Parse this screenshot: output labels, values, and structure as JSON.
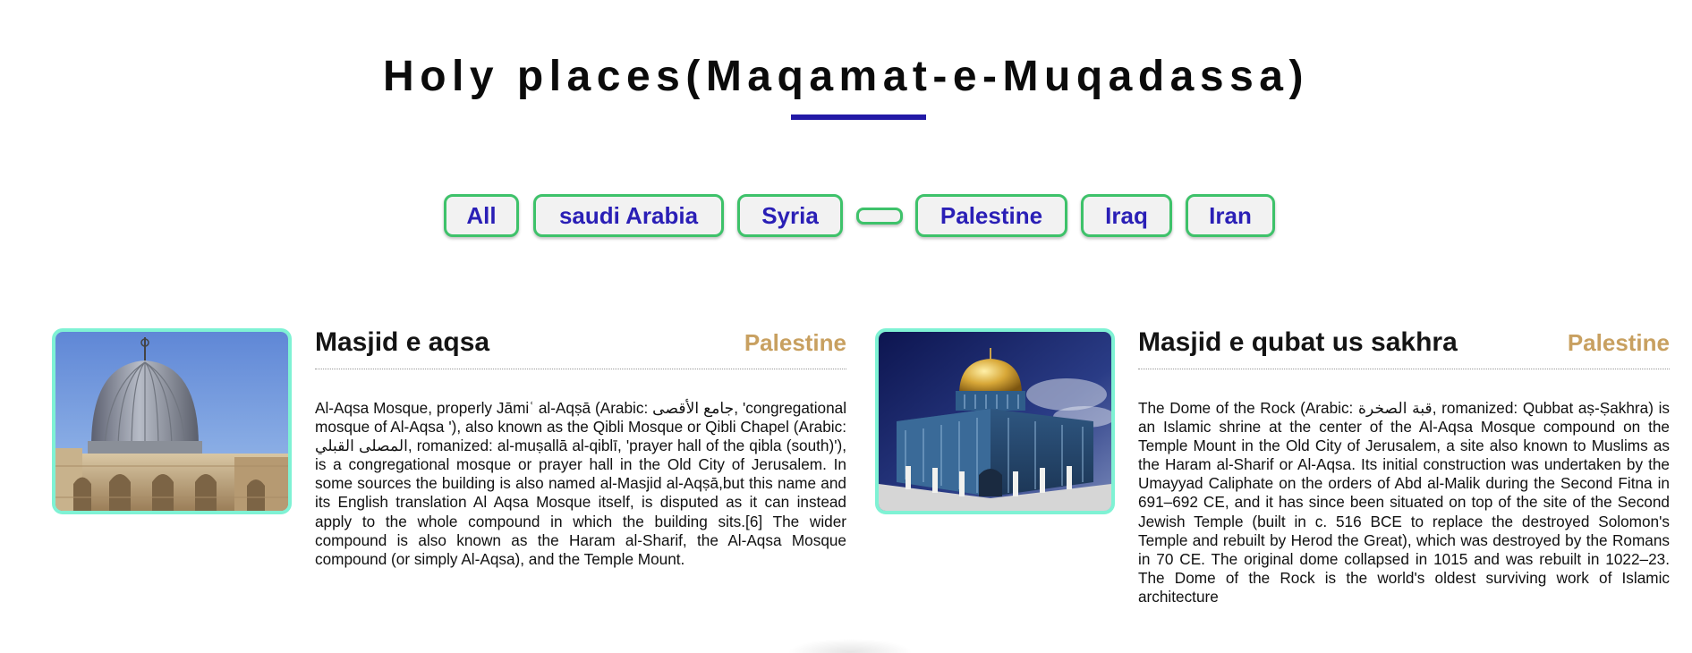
{
  "header": {
    "title": "Holy places(Maqamat-e-Muqadassa)",
    "accent_color": "#2219a6"
  },
  "filters": {
    "buttons": [
      {
        "label": "All"
      },
      {
        "label": "saudi Arabia"
      },
      {
        "label": "Syria"
      },
      {
        "label": ""
      },
      {
        "label": "Palestine"
      },
      {
        "label": "Iraq"
      },
      {
        "label": "Iran"
      }
    ],
    "border_color": "#3ec26a",
    "text_color": "#2a1fb6"
  },
  "cards": [
    {
      "title": "Masjid e aqsa",
      "country": "Palestine",
      "image": "silver-dome-mosque-photo",
      "description": "Al-Aqsa Mosque, properly Jāmiʿ al-Aqṣā (Arabic: جامع الأقصى, 'congregational mosque of Al-Aqsa '), also known as the Qibli Mosque or Qibli Chapel (Arabic: المصلى القبلي, romanized: al-muṣallā al-qiblī, 'prayer hall of the qibla (south)'), is a congregational mosque or prayer hall in the Old City of Jerusalem. In some sources the building is also named al-Masjid al-Aqṣā,but this name and its English translation Al Aqsa Mosque itself, is disputed as it can instead apply to the whole compound in which the building sits.[6] The wider compound is also known as the Haram al-Sharif, the Al-Aqsa Mosque compound (or simply Al-Aqsa), and the Temple Mount."
    },
    {
      "title": "Masjid e qubat us sakhra",
      "country": "Palestine",
      "image": "golden-dome-shrine-photo",
      "description": "The Dome of the Rock (Arabic: قبة الصخرة, romanized: Qubbat aṣ-Ṣakhra) is an Islamic shrine at the center of the Al-Aqsa Mosque compound on the Temple Mount in the Old City of Jerusalem, a site also known to Muslims as the Haram al-Sharif or Al-Aqsa. Its initial construction was undertaken by the Umayyad Caliphate on the orders of Abd al-Malik during the Second Fitna in 691–692 CE, and it has since been situated on top of the site of the Second Jewish Temple (built in c. 516 BCE to replace the destroyed Solomon's Temple and rebuilt by Herod the Great), which was destroyed by the Romans in 70 CE. The original dome collapsed in 1015 and was rebuilt in 1022–23. The Dome of the Rock is the world's oldest surviving work of Islamic architecture"
    }
  ],
  "card_style": {
    "image_border_color": "#7ff2d4",
    "country_color": "#c8a060"
  }
}
